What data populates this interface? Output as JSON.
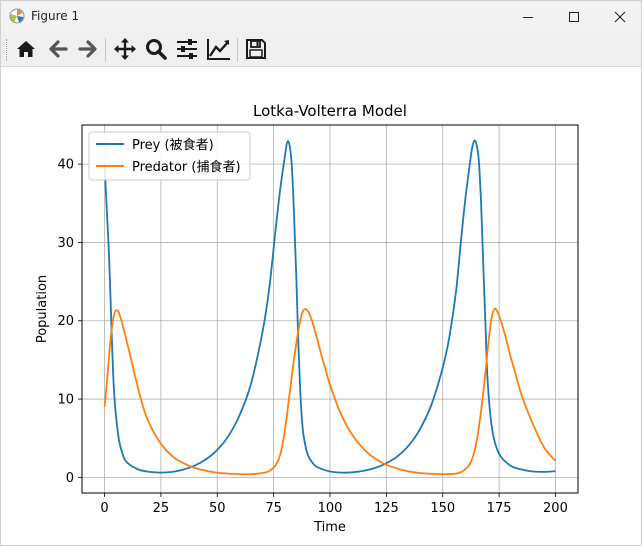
{
  "window": {
    "title": "Figure 1"
  },
  "toolbar": {
    "items": [
      "home-icon",
      "back-icon",
      "forward-icon",
      "pan-icon",
      "zoom-icon",
      "configure-subplots-icon",
      "edit-axis-icon",
      "save-icon"
    ]
  },
  "chart_data": {
    "type": "line",
    "title": "Lotka-Volterra Model",
    "xlabel": "Time",
    "ylabel": "Population",
    "xlim": [
      -10,
      210
    ],
    "ylim": [
      -2,
      45
    ],
    "xticks": [
      0,
      25,
      50,
      75,
      100,
      125,
      150,
      175,
      200
    ],
    "yticks": [
      0,
      10,
      20,
      30,
      40
    ],
    "grid": true,
    "legend_position": "upper-left",
    "series": [
      {
        "name": "Prey (被食者)",
        "color": "#1f77b4",
        "x": [
          0,
          2,
          4,
          6,
          8,
          10,
          15,
          20,
          25,
          30,
          35,
          40,
          45,
          50,
          55,
          60,
          65,
          70,
          73,
          76,
          78,
          80,
          81,
          82,
          83,
          84,
          85,
          86,
          87,
          88,
          90,
          93,
          96,
          100,
          105,
          110,
          115,
          120,
          125,
          130,
          135,
          140,
          145,
          150,
          153,
          156,
          158,
          160,
          162,
          163,
          164,
          165,
          166,
          167,
          168,
          169,
          170,
          172,
          175,
          180,
          185,
          190,
          195,
          200
        ],
        "y": [
          40,
          28,
          12,
          5.5,
          3,
          1.9,
          1.0,
          0.7,
          0.6,
          0.7,
          1.0,
          1.5,
          2.3,
          3.5,
          5.3,
          8.0,
          12,
          18.5,
          24,
          32,
          37,
          41,
          42.8,
          42.5,
          40,
          34,
          26,
          17,
          10,
          6,
          3,
          1.6,
          1.1,
          0.75,
          0.6,
          0.65,
          0.85,
          1.2,
          1.8,
          2.7,
          4.1,
          6.2,
          9.3,
          14,
          18,
          24,
          30,
          35.5,
          40,
          42,
          43,
          42.5,
          40.5,
          35,
          27,
          19,
          12,
          6,
          3,
          1.5,
          1.0,
          0.75,
          0.7,
          0.8
        ]
      },
      {
        "name": "Predator (捕食者)",
        "color": "#ff7f0e",
        "x": [
          0,
          1,
          2,
          3,
          4,
          5,
          6,
          7,
          8,
          10,
          12,
          15,
          18,
          21,
          25,
          30,
          35,
          40,
          45,
          50,
          55,
          60,
          65,
          70,
          73,
          76,
          78,
          80,
          82,
          84,
          86,
          87,
          88,
          89,
          90,
          91,
          92,
          94,
          96,
          98,
          100,
          105,
          110,
          115,
          120,
          125,
          130,
          135,
          140,
          145,
          150,
          155,
          158,
          161,
          163,
          165,
          167,
          169,
          170,
          171,
          172,
          173,
          174,
          176,
          178,
          180,
          182,
          185,
          190,
          195,
          200
        ],
        "y": [
          9,
          12,
          15.5,
          18.5,
          20.5,
          21.3,
          21.2,
          20.5,
          19.5,
          17.2,
          14.8,
          11.2,
          8.2,
          6.2,
          4.3,
          2.7,
          1.8,
          1.2,
          0.85,
          0.6,
          0.48,
          0.42,
          0.4,
          0.55,
          0.8,
          1.6,
          3,
          6,
          10.5,
          15,
          18.8,
          20.3,
          21.2,
          21.5,
          21.3,
          20.8,
          20,
          18,
          15.8,
          13.8,
          11.8,
          8,
          5.4,
          3.6,
          2.4,
          1.6,
          1.1,
          0.75,
          0.55,
          0.45,
          0.4,
          0.45,
          0.65,
          1.3,
          2.3,
          4.5,
          8.5,
          13.5,
          16.5,
          19,
          20.8,
          21.5,
          21.3,
          19.8,
          17.8,
          15.5,
          13.5,
          10.5,
          6.8,
          3.8,
          2.1
        ]
      }
    ]
  }
}
